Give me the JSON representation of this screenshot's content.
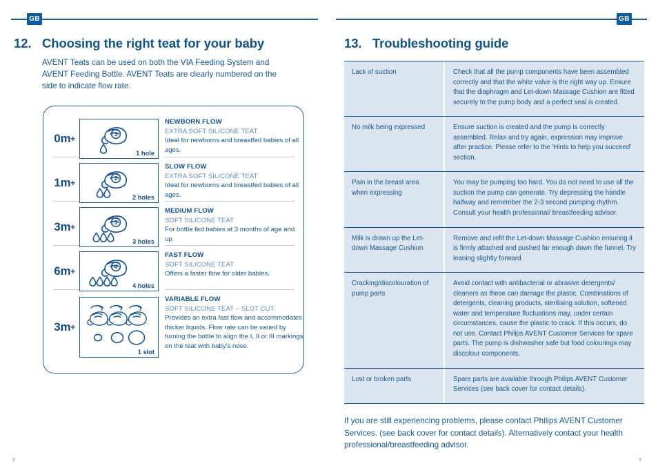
{
  "left_page": {
    "badge": "GB",
    "page_number": "8",
    "section": {
      "number": "12.",
      "title": "Choosing the right teat for your baby"
    },
    "intro": "AVENT Teats can be used on both the VIA Feeding System and AVENT Feeding Bottle. AVENT Teats are clearly numbered on the side to indicate flow rate.",
    "teat_table": {
      "rows": [
        {
          "age": "0m",
          "age_plus": "+",
          "teat_number": "1",
          "holes_label": "1 hole",
          "drops": 1,
          "flow_title": "NEWBORN FLOW",
          "flow_subtitle": "EXTRA SOFT SILICONE TEAT",
          "flow_description": "Ideal for newborns and breastfed babies of all ages."
        },
        {
          "age": "1m",
          "age_plus": "+",
          "teat_number": "2",
          "holes_label": "2 holes",
          "drops": 2,
          "flow_title": "SLOW FLOW",
          "flow_subtitle": "EXTRA SOFT SILICONE TEAT",
          "flow_description": "Ideal for newborns and breastfed babies of all ages."
        },
        {
          "age": "3m",
          "age_plus": "+",
          "teat_number": "3",
          "holes_label": "3 holes",
          "drops": 3,
          "flow_title": "MEDIUM FLOW",
          "flow_subtitle": "SOFT SILICONE TEAT",
          "flow_description": "For bottle fed babies at 3 months of age and up."
        },
        {
          "age": "6m",
          "age_plus": "+",
          "teat_number": "4",
          "holes_label": "4 holes",
          "drops": 4,
          "flow_title": "FAST FLOW",
          "flow_subtitle": "SOFT SILICONE TEAT",
          "flow_description": "Offers a faster flow for older babies."
        },
        {
          "age": "3m",
          "age_plus": "+",
          "teat_number": "",
          "holes_label": "1 slot",
          "drops": 0,
          "flow_title": "VARIABLE FLOW",
          "flow_subtitle": "SOFT SILICONE TEAT – SLOT CUT",
          "flow_description": "Provides an extra fast flow and accommodates thicker liquids. Flow rate can be varied by turning the bottle to align the I, II or III markings on the teat with baby’s nose."
        }
      ]
    }
  },
  "right_page": {
    "badge": "GB",
    "page_number": "9",
    "section": {
      "number": "13.",
      "title": "Troubleshooting guide"
    },
    "troubleshooting": {
      "rows": [
        {
          "problem": "Lack of suction",
          "solution": "Check that all the pump components have been assembled correctly and that the white valve is the right way up. Ensure that the diaphragm and Let-down Massage Cushion are fitted securely to the pump body and a perfect seal is created."
        },
        {
          "problem": "No milk being expressed",
          "solution": "Ensure suction is created and the pump is correctly assembled. Relax and try again, expression may improve after practice. Please refer to the ‘Hints to help you succeed’ section."
        },
        {
          "problem": "Pain in the breast area when expressing",
          "solution": "You may be pumping too hard. You do not need to use all the suction the pump can generate. Try depressing the handle halfway and remember the 2-3 second pumping rhythm. Consult your health professional/ breastfeeding advisor."
        },
        {
          "problem": "Milk is drawn up the Let-down Massage Cushion",
          "solution": "Remove and refit the Let-down Massage Cushion ensuring it is firmly attached and pushed far enough down the funnel. Try leaning slightly forward."
        },
        {
          "problem": "Cracking/discolouration of pump parts",
          "solution": "Avoid contact with antibacterial or abrasive detergents/ cleaners as these can damage the plastic. Combinations of detergents, cleaning products, sterilising solution, softened water and temperature fluctuations may, under certain circumstances, cause the plastic to crack. If this occurs, do not use. Contact Philips AVENT Customer Services for spare parts. The pump is dishwasher safe but food colourings may discolour components."
        },
        {
          "problem": "Lost or broken parts",
          "solution": "Spare parts are available through Philips AVENT Customer Services (see back cover for contact details)."
        }
      ]
    },
    "footer": "If you are still experiencing problems, please contact Philips AVENT Customer Services. (see back cover for contact details). Alternatively contact your health professional/breastfeeding advisor."
  },
  "colors": {
    "brand_blue": "#10538f",
    "mid_blue": "#1462a5",
    "light_blue_text": "#5e8db8",
    "table_cell_bg": "#dae5ef",
    "divider": "#b9cfe3"
  }
}
